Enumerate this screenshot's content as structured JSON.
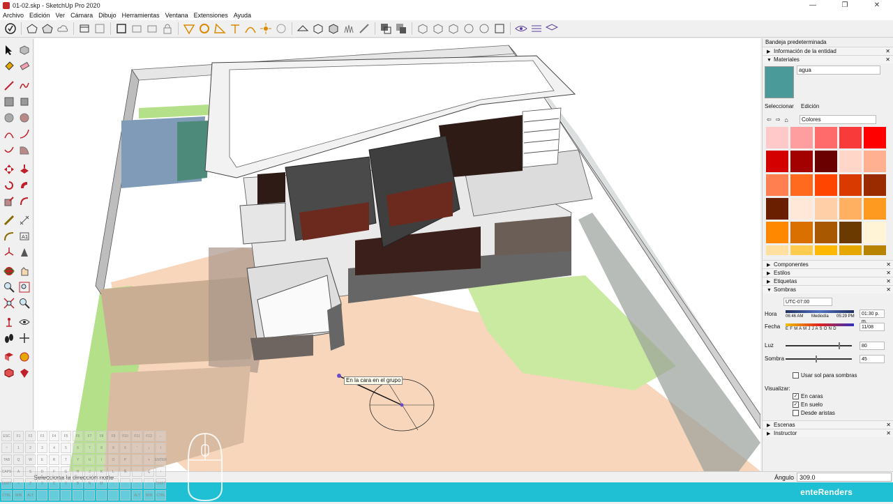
{
  "window": {
    "title": "01-02.skp - SketchUp Pro 2020",
    "min": "—",
    "max": "❐",
    "close": "✕"
  },
  "menu": [
    "Archivo",
    "Edición",
    "Ver",
    "Cámara",
    "Dibujo",
    "Herramientas",
    "Ventana",
    "Extensiones",
    "Ayuda"
  ],
  "viewport": {
    "tooltip": "En la cara en el grupo"
  },
  "panel": {
    "title": "Bandeja predeterminada",
    "entity_info": "Información de la entidad",
    "materials": "Materiales",
    "material_name": "agua",
    "tab_select": "Seleccionar",
    "tab_edit": "Edición",
    "collection": "Colores",
    "swatch_colors": [
      "#ffc9c9",
      "#ff9e9e",
      "#ff6b6b",
      "#f83a3a",
      "#ff0000",
      "#d40000",
      "#a30000",
      "#6b0000",
      "#ffd6c8",
      "#ffb090",
      "#ff7f50",
      "#ff6a1f",
      "#ff4500",
      "#d93a00",
      "#9a2a00",
      "#6a2000",
      "#ffe8d8",
      "#ffd0a8",
      "#ffb060",
      "#ff9a20",
      "#ff8800",
      "#d97000",
      "#a85800",
      "#6b3a00",
      "#fff4d6",
      "#ffe0a0",
      "#ffcc50",
      "#ffb800",
      "#e6a800",
      "#b88400"
    ],
    "components": "Componentes",
    "styles": "Estilos",
    "tags": "Etiquetas",
    "shadows": "Sombras",
    "timezone": "UTC-07:00",
    "hora_label": "Hora",
    "hora_start": "06:46 AM",
    "hora_mid": "Mediodía",
    "hora_end": "05:29 PM",
    "hora_value": "01:30 p. m.",
    "fecha_label": "Fecha",
    "months": "E F M A M J J A S O N D",
    "fecha_value": "11/08",
    "luz_label": "Luz",
    "luz_value": "80",
    "luz_level": 0.8,
    "sombra_label": "Sombra",
    "sombra_value": "45",
    "sombra_level": 0.45,
    "use_sun": "Usar sol para sombras",
    "visualize": "Visualizar:",
    "on_faces": "En caras",
    "on_ground": "En suelo",
    "from_edges": "Desde aristas",
    "scenes": "Escenas",
    "instructor": "Instructor"
  },
  "status": {
    "message": "Selecciona la dirección norte",
    "angle_label": "Ángulo",
    "angle_value": "309.0"
  },
  "brand": "enteRenders",
  "keyboard": {
    "row1": [
      "ESC",
      "F1",
      "F2",
      "F3",
      "F4",
      "F5",
      "F6",
      "F7",
      "F8",
      "F9",
      "F10",
      "F11",
      "F12",
      "←"
    ],
    "row2": [
      "º",
      "1",
      "2",
      "3",
      "4",
      "5",
      "6",
      "7",
      "8",
      "9",
      "0",
      "'",
      "¡",
      "\\"
    ],
    "row3": [
      "TAB",
      "Q",
      "W",
      "E",
      "R",
      "T",
      "Y",
      "U",
      "I",
      "O",
      "P",
      "`",
      "+",
      "ENTER"
    ],
    "row4": [
      "CAPS",
      "A",
      "S",
      "D",
      "F",
      "G",
      "H",
      "J",
      "K",
      "L",
      "Ñ",
      "´",
      "Ç",
      "↑"
    ],
    "row5": [
      "SHIFT",
      "<",
      "Z",
      "X",
      "C",
      "V",
      "B",
      "N",
      "M",
      ",",
      ".",
      "-",
      "↑",
      "SHIFT"
    ],
    "row6": [
      "CTRL",
      "WIN",
      "ALT",
      "",
      "",
      "",
      "",
      "",
      "",
      "",
      "",
      "ALT",
      "WIN",
      "CTRL"
    ]
  }
}
